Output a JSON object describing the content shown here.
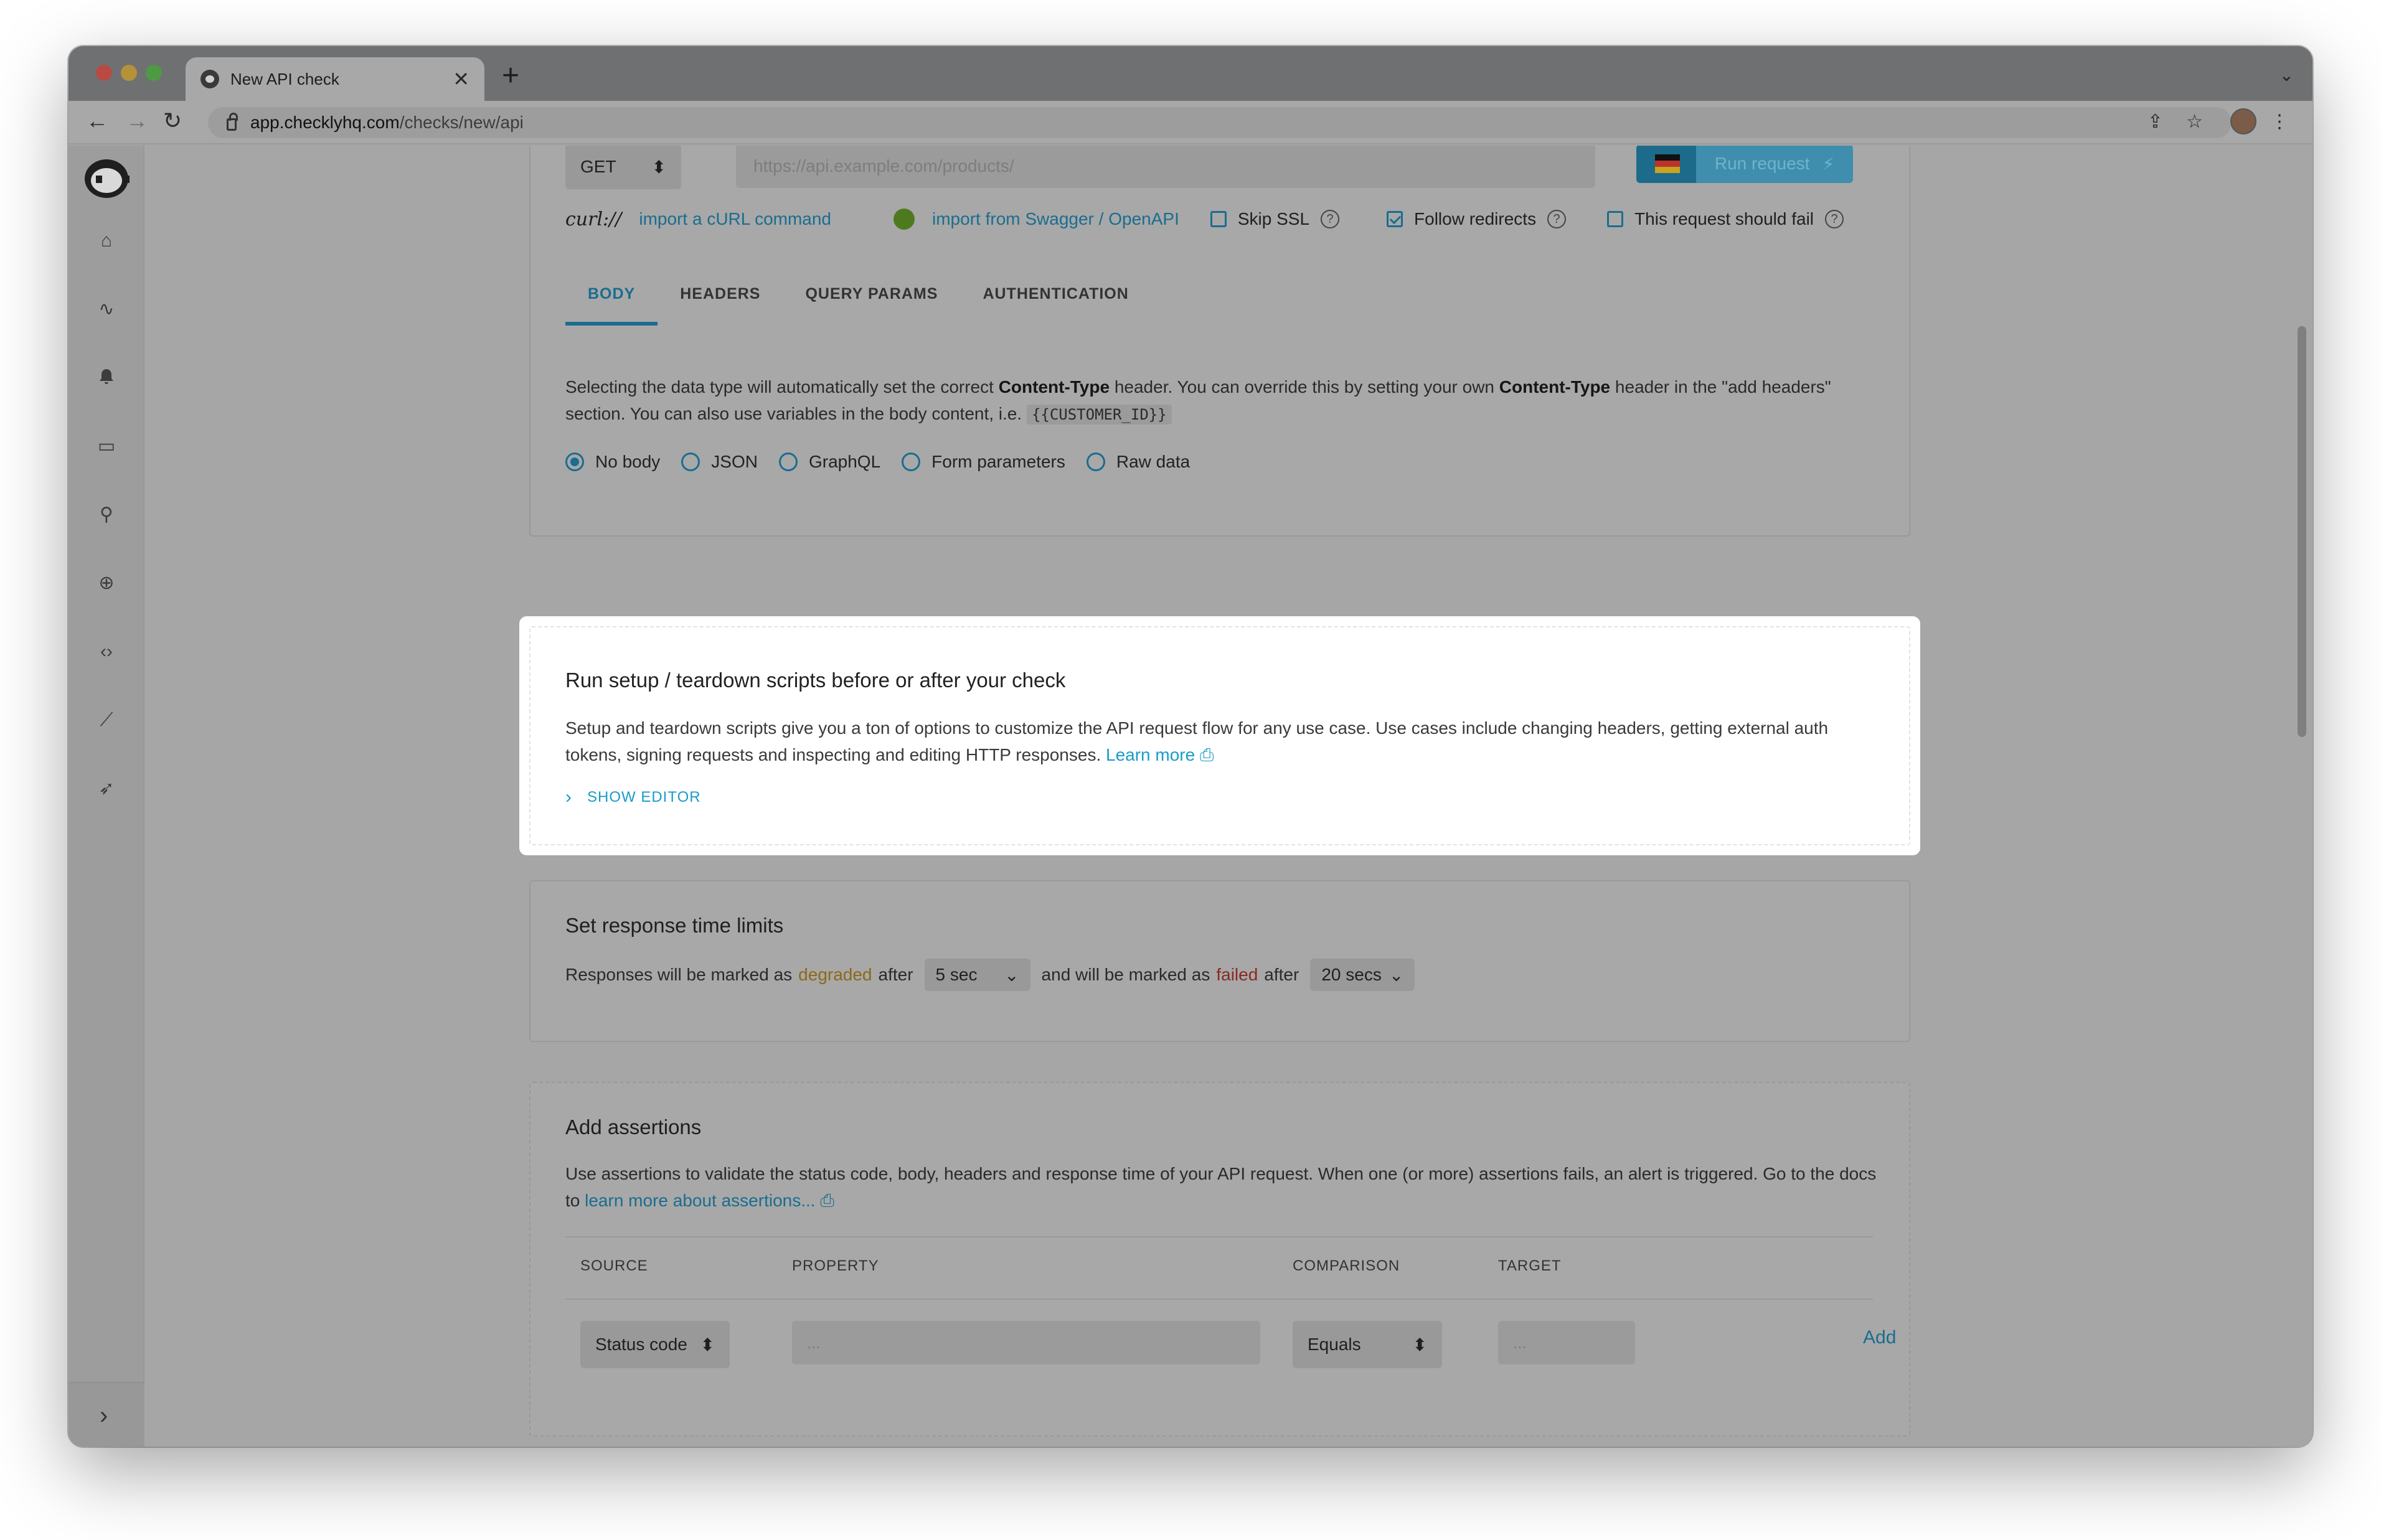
{
  "browser": {
    "tab_title": "New API check",
    "tab_close": "✕",
    "new_tab": "+",
    "url_host": "app.checklyhq.com",
    "url_path": "/checks/new/api"
  },
  "sidebar": {
    "items": [
      {
        "icon": "home-icon",
        "glyph": "⌂"
      },
      {
        "icon": "activity-icon",
        "glyph": "∿"
      },
      {
        "icon": "bell-icon",
        "glyph": "🔔"
      },
      {
        "icon": "monitor-icon",
        "glyph": "▭"
      },
      {
        "icon": "heartbeat-icon",
        "glyph": "⚲"
      },
      {
        "icon": "globe-icon",
        "glyph": "⊕"
      },
      {
        "icon": "code-icon",
        "glyph": "‹›"
      },
      {
        "icon": "chart-icon",
        "glyph": "⟋"
      },
      {
        "icon": "rocket-icon",
        "glyph": "➶"
      }
    ],
    "expand_glyph": "›"
  },
  "request": {
    "method": "GET",
    "url_placeholder": "https://api.example.com/products/",
    "run_label": "Run request",
    "curl_logo": "curl://",
    "import_curl": "import a cURL command",
    "import_swagger": "import from Swagger / OpenAPI",
    "skip_ssl": "Skip SSL",
    "follow_redirects": "Follow redirects",
    "should_fail": "This request should fail",
    "help": "?",
    "tabs": [
      "BODY",
      "HEADERS",
      "QUERY PARAMS",
      "AUTHENTICATION"
    ],
    "body_desc": {
      "p1": "Selecting the data type will automatically set the correct ",
      "b1": "Content-Type",
      "p2": " header. You can override this by setting your own ",
      "b2": "Content-Type",
      "p3": " header in the \"add headers\" section. You can also use variables in the body content, i.e. ",
      "code": "{{CUSTOMER_ID}}"
    },
    "body_types": [
      "No body",
      "JSON",
      "GraphQL",
      "Form parameters",
      "Raw data"
    ]
  },
  "scripts": {
    "title": "Run setup / teardown scripts before or after your check",
    "desc": "Setup and teardown scripts give you a ton of options to customize the API request flow for any use case. Use cases include changing headers, getting external auth tokens, signing requests and inspecting and editing HTTP responses. ",
    "learn_more": "Learn more",
    "ext_icon": "⎙",
    "show_editor": "SHOW EDITOR",
    "chevron": "›"
  },
  "response_limits": {
    "title": "Set response time limits",
    "t1": "Responses will be marked as",
    "degraded": "degraded",
    "t2": "after",
    "degraded_value": "5 sec",
    "t3": "and will be marked as",
    "failed": "failed",
    "t4": "after",
    "failed_value": "20 secs",
    "caret": "⌄"
  },
  "assertions": {
    "title": "Add assertions",
    "desc": "Use assertions to validate the status code, body, headers and response time of your API request. When one (or more) assertions fails, an alert is triggered. Go to the docs to ",
    "link": "learn more about assertions...",
    "ext_icon": "⎙",
    "headers": [
      "SOURCE",
      "PROPERTY",
      "COMPARISON",
      "TARGET"
    ],
    "source": "Status code",
    "property_placeholder": "...",
    "comparison": "Equals",
    "target_placeholder": "...",
    "add": "Add",
    "updown": "⬍"
  },
  "colors": {
    "accent": "#1a9cc7",
    "degraded": "#c9a21f",
    "failed": "#c0392b"
  }
}
